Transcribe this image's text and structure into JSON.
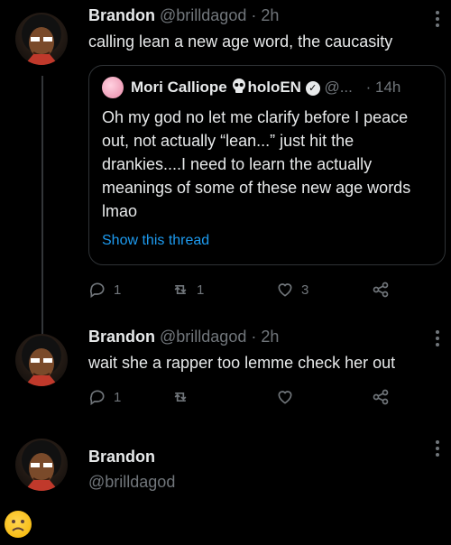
{
  "tweet1": {
    "name": "Brandon",
    "handle": "@brilldagod",
    "time": "· 2h",
    "text": "calling lean a new age word, the caucasity",
    "quote": {
      "name": "Mori Calliope",
      "name_suffix": "holoEN",
      "handle": "@...",
      "time": "· 14h",
      "text": "Oh my god no let me clarify before I peace out, not actually “lean...” just hit the drankies....I need to learn the actually meanings of some of these new age words lmao",
      "show_thread": "Show this thread"
    },
    "actions": {
      "replies": "1",
      "retweets": "1",
      "likes": "3"
    }
  },
  "tweet2": {
    "name": "Brandon",
    "handle": "@brilldagod",
    "time": "· 2h",
    "text": "wait she a rapper too lemme check her out",
    "actions": {
      "replies": "1",
      "retweets": "",
      "likes": ""
    }
  },
  "profile": {
    "name": "Brandon",
    "handle": "@brilldagod"
  },
  "icons": {
    "reply": "reply-icon",
    "retweet": "retweet-icon",
    "like": "heart-icon",
    "share": "share-icon",
    "more": "more-icon",
    "sad": "sad-face-icon"
  },
  "colors": {
    "link": "#1d9bf0",
    "muted": "#71767b",
    "text": "#e7e9ea",
    "background": "#000000"
  }
}
